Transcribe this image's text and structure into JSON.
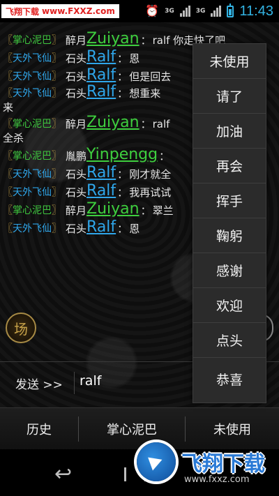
{
  "status_bar": {
    "watermark": "飞翔下载",
    "watermark_url": "www.FXXZ.com",
    "network_type": "3G",
    "network_type2": "3G",
    "clock": "11:43",
    "battery_color": "#33b5e5"
  },
  "chat": {
    "messages": [
      {
        "group": "掌心泥巴",
        "group_color": "green",
        "nick": "醉月",
        "handle": "Zuiyan",
        "sep": "：",
        "text": "ralf 你走快了吧"
      },
      {
        "group": "天外飞仙",
        "group_color": "blue",
        "nick": "石头",
        "handle": "Ralf",
        "sep": "：",
        "text": "恩"
      },
      {
        "group": "天外飞仙",
        "group_color": "blue",
        "nick": "石头",
        "handle": "Ralf",
        "sep": "：",
        "text": "但是回去"
      },
      {
        "group": "天外飞仙",
        "group_color": "blue",
        "nick": "石头",
        "handle": "Ralf",
        "sep": "：",
        "text": "想重来",
        "cont": "来"
      },
      {
        "group": "掌心泥巴",
        "group_color": "green",
        "nick": "醉月",
        "handle": "Zuiyan",
        "sep": "：",
        "text": "ralf",
        "cont": "全杀"
      },
      {
        "group": "掌心泥巴",
        "group_color": "green",
        "nick": "胤鹏",
        "handle": "Yinpengg",
        "sep": "：",
        "text": ""
      },
      {
        "group": "天外飞仙",
        "group_color": "blue",
        "nick": "石头",
        "handle": "Ralf",
        "sep": "：",
        "text": "刚才就全"
      },
      {
        "group": "天外飞仙",
        "group_color": "blue",
        "nick": "石头",
        "handle": "Ralf",
        "sep": "：",
        "text": "我再试试"
      },
      {
        "group": "掌心泥巴",
        "group_color": "green",
        "nick": "醉月",
        "handle": "Zuiyan",
        "sep": "：",
        "text": "翠兰"
      },
      {
        "group": "天外飞仙",
        "group_color": "blue",
        "nick": "石头",
        "handle": "Ralf",
        "sep": "：",
        "text": "恩"
      }
    ],
    "scene_badge": "场"
  },
  "input": {
    "send_label": "发送 >>",
    "value": "ralf"
  },
  "tabs": {
    "history": "历史",
    "channel": "掌心泥巴",
    "unused": "未使用"
  },
  "popup_menu": {
    "items": [
      "未使用",
      "请了",
      "加油",
      "再会",
      "挥手",
      "鞠躬",
      "感谢",
      "欢迎",
      "点头",
      "恭喜"
    ]
  },
  "brand": {
    "name": "飞翔下载",
    "url": "www.fxxz.com"
  }
}
